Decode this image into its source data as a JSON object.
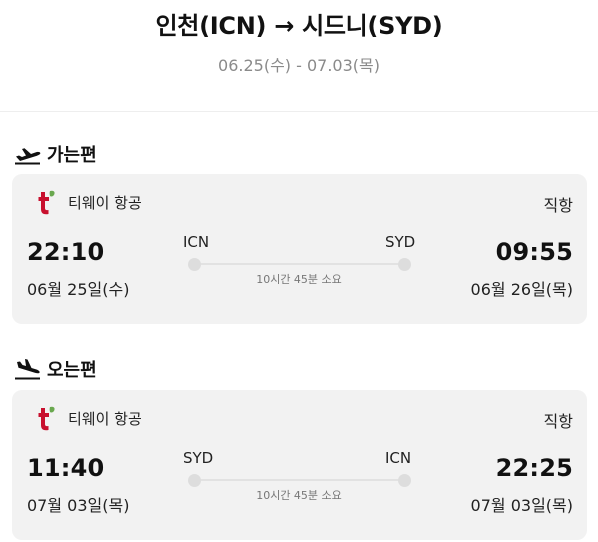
{
  "header": {
    "title": "인천(ICN) → 시드니(SYD)",
    "dates": "06.25(수) - 07.03(목)"
  },
  "colors": {
    "accent_logo": "#c8102e",
    "logo_leaf": "#6aa84f",
    "card_bg": "#f2f2f2",
    "muted_text": "#8a8a8a"
  },
  "outbound": {
    "section_label": "가는편",
    "section_icon": "plane-takeoff-icon",
    "airline": "티웨이 항공",
    "airline_icon": "tway-logo-icon",
    "direct_label": "직항",
    "dep_time": "22:10",
    "dep_date": "06월 25일(수)",
    "dep_code": "ICN",
    "arr_code": "SYD",
    "duration": "10시간 45분 소요",
    "arr_time": "09:55",
    "arr_date": "06월 26일(목)"
  },
  "inbound": {
    "section_label": "오는편",
    "section_icon": "plane-landing-icon",
    "airline": "티웨이 항공",
    "airline_icon": "tway-logo-icon",
    "direct_label": "직항",
    "dep_time": "11:40",
    "dep_date": "07월 03일(목)",
    "dep_code": "SYD",
    "arr_code": "ICN",
    "duration": "10시간 45분 소요",
    "arr_time": "22:25",
    "arr_date": "07월 03일(목)"
  }
}
